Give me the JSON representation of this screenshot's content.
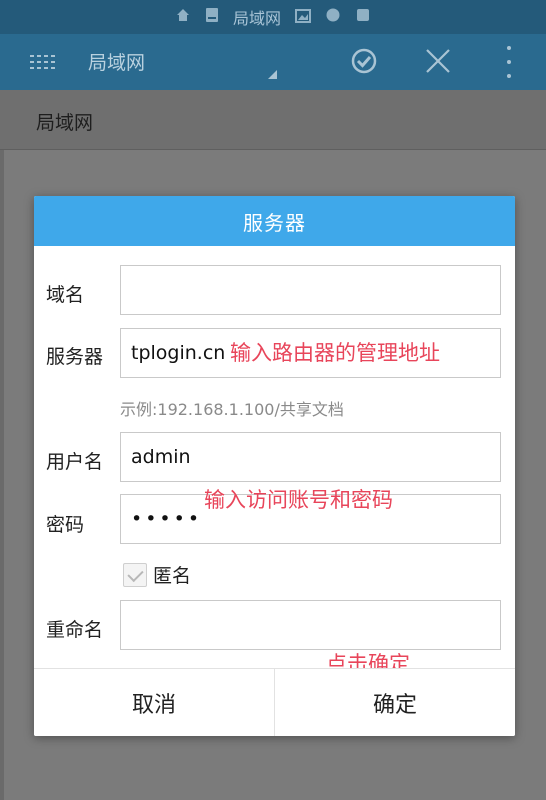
{
  "statusbar": {
    "title": "局域网"
  },
  "appbar": {
    "title": "局域网"
  },
  "subheader": {
    "title": "局域网"
  },
  "dialog": {
    "title": "服务器",
    "fields": {
      "domain": {
        "label": "域名",
        "value": ""
      },
      "server": {
        "label": "服务器",
        "value": "tplogin.cn"
      },
      "server_hint": "示例:192.168.1.100/共享文档",
      "username": {
        "label": "用户名",
        "value": "admin"
      },
      "password": {
        "label": "密码",
        "value": "•••••"
      },
      "anonymous": {
        "label": "匿名",
        "checked": true
      },
      "rename": {
        "label": "重命名",
        "value": ""
      }
    },
    "buttons": {
      "cancel": "取消",
      "confirm": "确定"
    }
  },
  "annotations": {
    "server": "输入路由器的管理地址",
    "credentials": "输入访问账号和密码",
    "confirm": "点击确定"
  },
  "colors": {
    "appbar": "#2a6a8f",
    "statusbar": "#245a7a",
    "dialog_header": "#3fa8ea",
    "annotation": "#e8455a"
  }
}
